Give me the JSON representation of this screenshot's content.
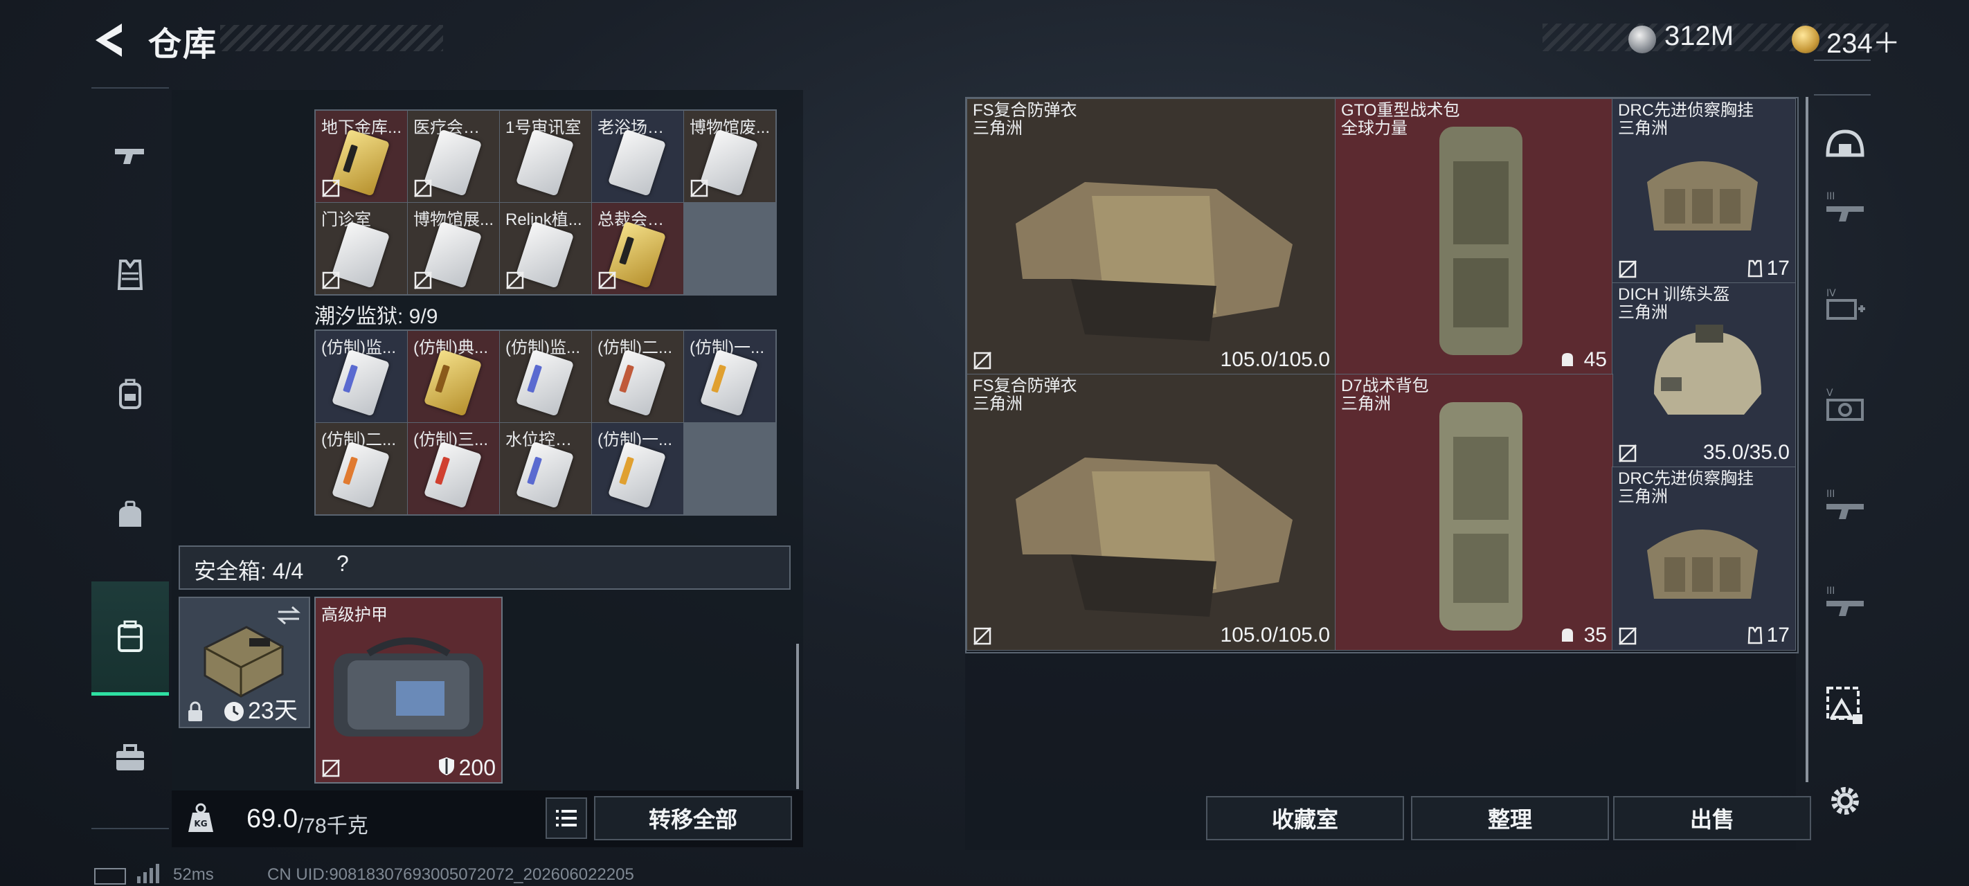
{
  "header": {
    "title": "仓库",
    "silver_amount": "312M",
    "gold_amount": "234＋"
  },
  "sidebar": {
    "items": [
      "weapon-icon",
      "armor-vest-icon",
      "backpack-icon",
      "pouch-icon",
      "safe-case-icon",
      "toolbox-icon"
    ],
    "active": "safe-case-icon"
  },
  "left": {
    "top_cards": [
      {
        "label": "地下金库...",
        "type": "gold"
      },
      {
        "label": "医疗会议室",
        "type": "silver"
      },
      {
        "label": "1号审讯室",
        "type": "silver"
      },
      {
        "label": "老浴场餐厅",
        "type": "silver"
      },
      {
        "label": "博物馆废...",
        "type": "silver"
      },
      {
        "label": "门诊室",
        "type": "silver"
      },
      {
        "label": "博物馆展...",
        "type": "silver"
      },
      {
        "label": "Relink植...",
        "type": "silver"
      },
      {
        "label": "总裁会议室",
        "type": "gold"
      }
    ],
    "section_title": "潮汐监狱: 9/9",
    "prison_cards": [
      {
        "label": "(仿制)监...",
        "type": "silver",
        "accent": "#5a6ad0"
      },
      {
        "label": "(仿制)典...",
        "type": "gold",
        "accent": "#c08a2a"
      },
      {
        "label": "(仿制)监...",
        "type": "silver",
        "accent": "#5a6ad0"
      },
      {
        "label": "(仿制)二...",
        "type": "silver",
        "accent": "#c05a3a"
      },
      {
        "label": "(仿制)一...",
        "type": "silver",
        "accent": "#e0a030"
      },
      {
        "label": "(仿制)二...",
        "type": "silver",
        "accent": "#e07a30"
      },
      {
        "label": "(仿制)三...",
        "type": "silver",
        "accent": "#d04030"
      },
      {
        "label": "水位控制室",
        "type": "silver",
        "accent": "#5a6ad0"
      },
      {
        "label": "(仿制)一...",
        "type": "silver",
        "accent": "#e0a030"
      }
    ],
    "safe_label": "安全箱: 4/4",
    "help": "?",
    "case_days": "23天",
    "armor_item": {
      "name": "高级护甲",
      "value": "200"
    },
    "weight_current": "69.0",
    "weight_max": "/78千克",
    "transfer_all": "转移全部"
  },
  "right": {
    "items": [
      {
        "name": "FS复合防弹衣",
        "sub": "三角洲",
        "value": "105.0/105.0"
      },
      {
        "name": "GTO重型战术包",
        "sub": "全球力量",
        "value": "45"
      },
      {
        "name": "DRC先进侦察胸挂",
        "sub": "三角洲",
        "value": "17"
      },
      {
        "name": "DICH 训练头盔",
        "sub": "三角洲",
        "value": "35.0/35.0"
      },
      {
        "name": "FS复合防弹衣",
        "sub": "三角洲",
        "value": "105.0/105.0"
      },
      {
        "name": "D7战术背包",
        "sub": "三角洲",
        "value": "35"
      },
      {
        "name": "DRC先进侦察胸挂",
        "sub": "三角洲",
        "value": "17"
      }
    ],
    "buttons": {
      "collection": "收藏室",
      "sort": "整理",
      "sell": "出售"
    }
  },
  "rail": {
    "icons": [
      "helmet-icon",
      "rifle-icon",
      "attachment-icon",
      "scope-icon",
      "rifle-icon",
      "rifle-icon",
      "item-filter-icon",
      "gear-icon"
    ]
  },
  "status": {
    "ping": "52ms",
    "uid": "CN UID:9081830769300507​2072_202606022205"
  }
}
